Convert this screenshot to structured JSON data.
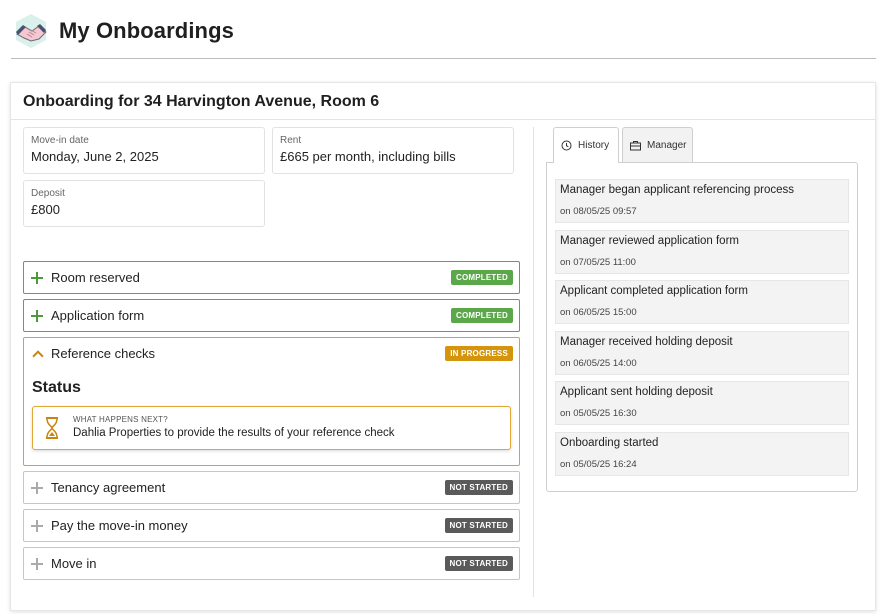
{
  "header": {
    "title": "My Onboardings",
    "logo_icon": "handshake-icon"
  },
  "onboarding": {
    "title": "Onboarding for 34 Harvington Avenue, Room 6",
    "details": {
      "move_in": {
        "label": "Move-in date",
        "value": "Monday, June 2, 2025"
      },
      "rent": {
        "label": "Rent",
        "value": "£665 per month, including bills"
      },
      "deposit": {
        "label": "Deposit",
        "value": "£800"
      }
    },
    "steps": [
      {
        "label": "Room reserved",
        "status": "COMPLETED",
        "status_color": "#5aa84a"
      },
      {
        "label": "Application form",
        "status": "COMPLETED",
        "status_color": "#5aa84a"
      },
      {
        "label": "Reference checks",
        "status": "IN PROGRESS",
        "status_color": "#d4950c"
      },
      {
        "label": "Tenancy agreement",
        "status": "NOT STARTED",
        "status_color": "#5a5a5a"
      },
      {
        "label": "Pay the move-in money",
        "status": "NOT STARTED",
        "status_color": "#5a5a5a"
      },
      {
        "label": "Move in",
        "status": "NOT STARTED",
        "status_color": "#5a5a5a"
      }
    ],
    "status_panel": {
      "title": "Status",
      "next_label": "WHAT HAPPENS NEXT?",
      "next_text": "Dahlia Properties to provide the results of your reference check"
    }
  },
  "tabs": [
    {
      "label": "History",
      "icon": "clock-icon",
      "active": true
    },
    {
      "label": "Manager",
      "icon": "briefcase-icon",
      "active": false
    }
  ],
  "history": [
    {
      "text": "Manager began applicant referencing process",
      "date": "on 08/05/25 09:57"
    },
    {
      "text": "Manager reviewed application form",
      "date": "on 07/05/25 11:00"
    },
    {
      "text": "Applicant completed application form",
      "date": "on 06/05/25 15:00"
    },
    {
      "text": "Manager received holding deposit",
      "date": "on 06/05/25 14:00"
    },
    {
      "text": "Applicant sent holding deposit",
      "date": "on 05/05/25 16:30"
    },
    {
      "text": "Onboarding started",
      "date": "on 05/05/25 16:24"
    }
  ],
  "colors": {
    "completed": "#5aa84a",
    "in_progress": "#d4950c",
    "not_started": "#5a5a5a",
    "active_border": "#dfa125"
  }
}
